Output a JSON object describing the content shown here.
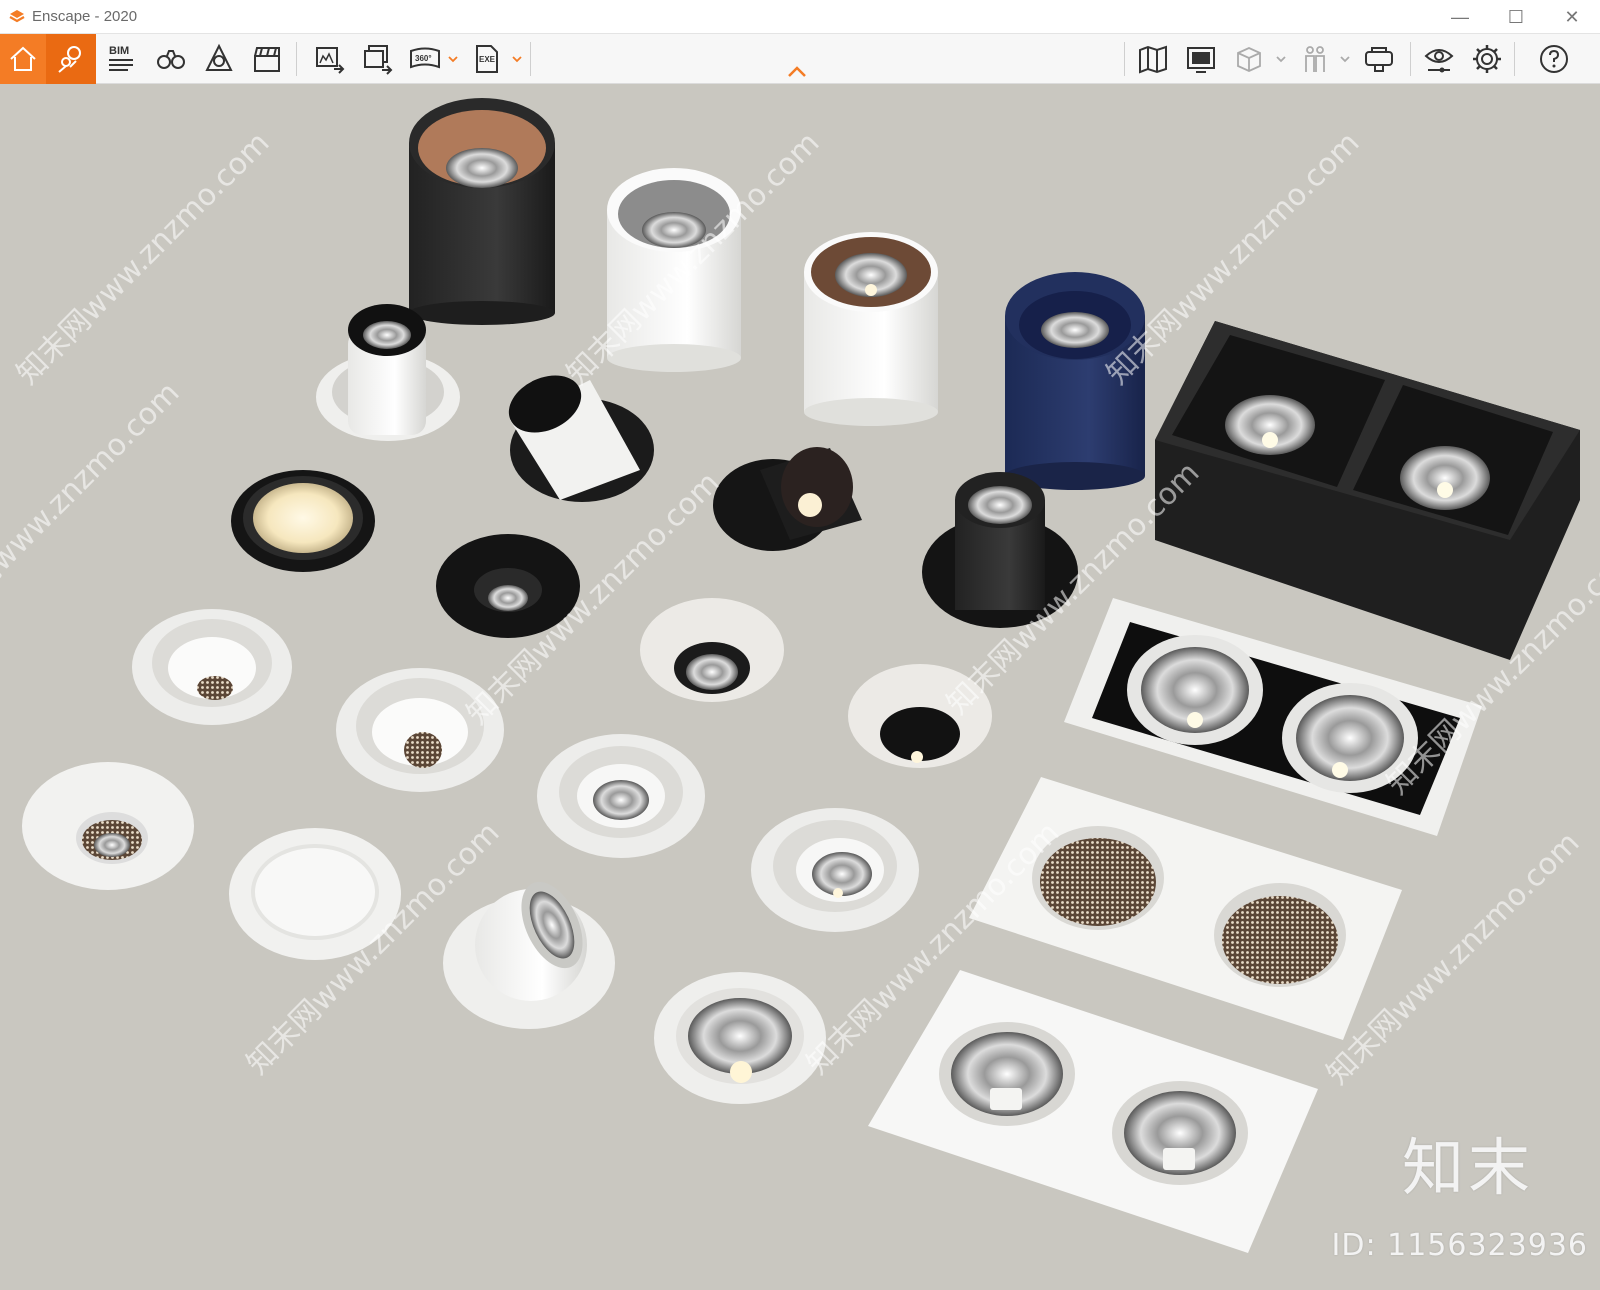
{
  "window": {
    "title": "Enscape - 2020",
    "controls": [
      "—",
      "☐",
      "✕"
    ]
  },
  "toolbar": {
    "bim_label": "BIM",
    "left_tools": [
      {
        "name": "home",
        "icon": "home-icon"
      },
      {
        "name": "views",
        "icon": "location-pins-icon"
      },
      {
        "name": "bim",
        "icon": "bim-icon"
      },
      {
        "name": "binoculars",
        "icon": "binoculars-icon"
      },
      {
        "name": "atmosphere",
        "icon": "bell-atmosphere-icon"
      },
      {
        "name": "video-editor",
        "icon": "clapperboard-icon"
      },
      {
        "name": "render-image",
        "icon": "render-image-icon"
      },
      {
        "name": "batch-render",
        "icon": "batch-render-icon"
      },
      {
        "name": "panorama",
        "icon": "panorama-360-icon",
        "label": "360°"
      },
      {
        "name": "export-exe",
        "icon": "export-exe-icon",
        "label": "EXE"
      }
    ],
    "right_tools": [
      {
        "name": "map",
        "icon": "map-icon"
      },
      {
        "name": "screenshot",
        "icon": "render-monitor-icon"
      },
      {
        "name": "box",
        "icon": "cube-icon"
      },
      {
        "name": "people",
        "icon": "people-icon"
      },
      {
        "name": "vr",
        "icon": "vr-headset-icon"
      },
      {
        "name": "visual-settings",
        "icon": "eye-settings-icon"
      },
      {
        "name": "general-settings",
        "icon": "gear-icon"
      },
      {
        "name": "help",
        "icon": "help-icon"
      }
    ]
  },
  "viewport": {
    "background": "#c9c7c0",
    "watermark_logo": "知末",
    "watermark_id": "ID: 1156323936",
    "diagonal_watermark": "知末网www.znzmo.com"
  },
  "colors": {
    "accent": "#f47c25",
    "accent_dark": "#ea6a12"
  }
}
